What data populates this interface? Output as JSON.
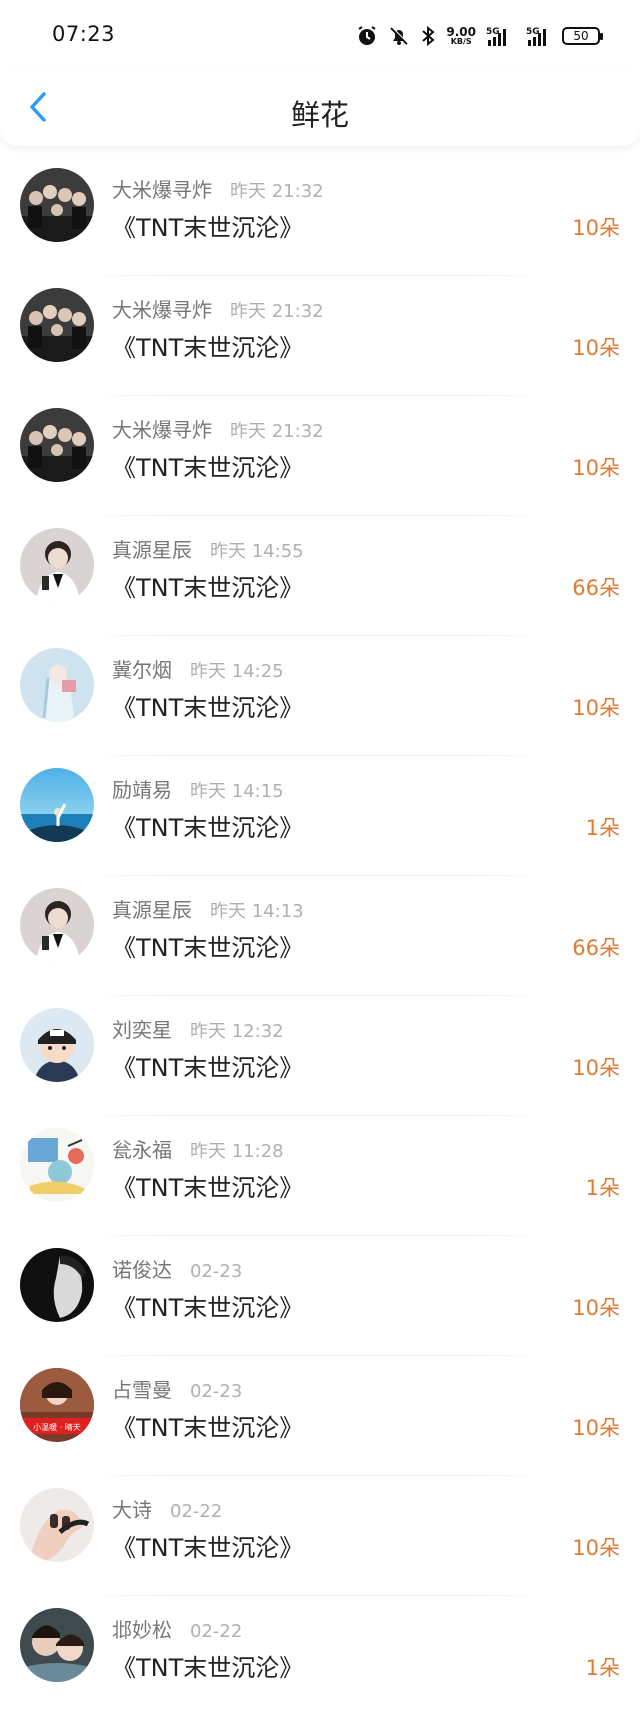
{
  "status_bar": {
    "time": "07:23",
    "net_speed_value": "9.00",
    "net_speed_unit": "KB/S",
    "net_type_1": "5G",
    "net_type_2": "5G",
    "battery": "50"
  },
  "header": {
    "title": "鲜花",
    "back_icon": "chevron-left-icon"
  },
  "records": [
    {
      "name": "大米爆寻炸",
      "time": "昨天 21:32",
      "novel": "《TNT末世沉沦》",
      "count": "10朵",
      "avatar": "group-photo"
    },
    {
      "name": "大米爆寻炸",
      "time": "昨天 21:32",
      "novel": "《TNT末世沉沦》",
      "count": "10朵",
      "avatar": "group-photo"
    },
    {
      "name": "大米爆寻炸",
      "time": "昨天 21:32",
      "novel": "《TNT末世沉沦》",
      "count": "10朵",
      "avatar": "group-photo"
    },
    {
      "name": "真源星辰",
      "time": "昨天 14:55",
      "novel": "《TNT末世沉沦》",
      "count": "66朵",
      "avatar": "singer-photo"
    },
    {
      "name": "冀尔烟",
      "time": "昨天 14:25",
      "novel": "《TNT末世沉沦》",
      "count": "10朵",
      "avatar": "light-blue-figure"
    },
    {
      "name": "励靖易",
      "time": "昨天 14:15",
      "novel": "《TNT末世沉沦》",
      "count": "1朵",
      "avatar": "beach-photo"
    },
    {
      "name": "真源星辰",
      "time": "昨天 14:13",
      "novel": "《TNT末世沉沦》",
      "count": "66朵",
      "avatar": "singer-photo"
    },
    {
      "name": "刘奕星",
      "time": "昨天 12:32",
      "novel": "《TNT末世沉沦》",
      "count": "10朵",
      "avatar": "cartoon-cap"
    },
    {
      "name": "瓮永福",
      "time": "昨天 11:28",
      "novel": "《TNT末世沉沦》",
      "count": "1朵",
      "avatar": "cartoon-scene"
    },
    {
      "name": "诺俊达",
      "time": "02-23",
      "novel": "《TNT末世沉沦》",
      "count": "10朵",
      "avatar": "bw-portrait"
    },
    {
      "name": "占雪曼",
      "time": "02-23",
      "novel": "《TNT末世沉沦》",
      "count": "10朵",
      "avatar": "red-banner"
    },
    {
      "name": "大诗",
      "time": "02-22",
      "novel": "《TNT末世沉沦》",
      "count": "10朵",
      "avatar": "hand-nails"
    },
    {
      "name": "邶妙松",
      "time": "02-22",
      "novel": "《TNT末世沉沦》",
      "count": "1朵",
      "avatar": "couple-photo"
    }
  ],
  "avatar_banner_text": "小温暖 · 晴天",
  "colors": {
    "accent": "#2b9bf4",
    "count": "#e07b34",
    "name": "#777777",
    "time": "#b0b0b0"
  }
}
